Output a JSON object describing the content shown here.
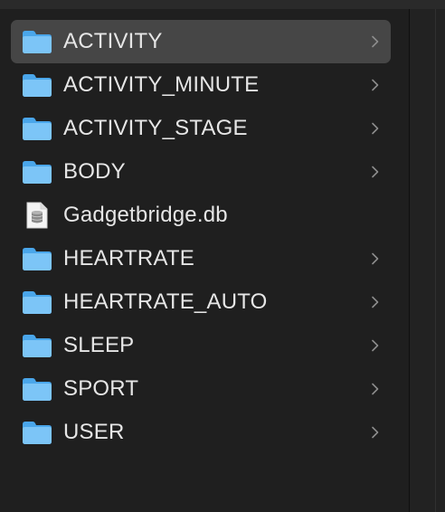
{
  "colors": {
    "background": "#1f1f1f",
    "selected_row": "#464646",
    "text": "#e6e6e6",
    "chevron": "#8c8c8c",
    "folder_light": "#7cc5f7",
    "folder_dark": "#4aa6ea"
  },
  "items": [
    {
      "label": "ACTIVITY",
      "icon": "folder-icon",
      "has_chevron": true,
      "selected": true
    },
    {
      "label": "ACTIVITY_MINUTE",
      "icon": "folder-icon",
      "has_chevron": true,
      "selected": false
    },
    {
      "label": "ACTIVITY_STAGE",
      "icon": "folder-icon",
      "has_chevron": true,
      "selected": false
    },
    {
      "label": "BODY",
      "icon": "folder-icon",
      "has_chevron": true,
      "selected": false
    },
    {
      "label": "Gadgetbridge.db",
      "icon": "database-file-icon",
      "has_chevron": false,
      "selected": false
    },
    {
      "label": "HEARTRATE",
      "icon": "folder-icon",
      "has_chevron": true,
      "selected": false
    },
    {
      "label": "HEARTRATE_AUTO",
      "icon": "folder-icon",
      "has_chevron": true,
      "selected": false
    },
    {
      "label": "SLEEP",
      "icon": "folder-icon",
      "has_chevron": true,
      "selected": false
    },
    {
      "label": "SPORT",
      "icon": "folder-icon",
      "has_chevron": true,
      "selected": false
    },
    {
      "label": "USER",
      "icon": "folder-icon",
      "has_chevron": true,
      "selected": false
    }
  ]
}
